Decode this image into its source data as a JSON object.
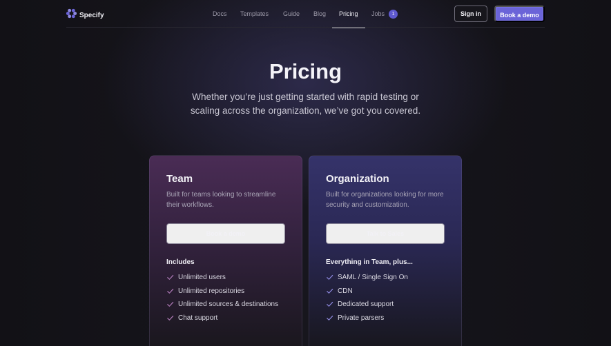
{
  "header": {
    "brand": "Specify",
    "nav": [
      {
        "label": "Docs"
      },
      {
        "label": "Templates"
      },
      {
        "label": "Guide"
      },
      {
        "label": "Blog"
      },
      {
        "label": "Pricing",
        "active": true
      },
      {
        "label": "Jobs",
        "badge": "1"
      }
    ],
    "signin_label": "Sign in",
    "demo_label": "Book a demo"
  },
  "hero": {
    "title": "Pricing",
    "subtitle": "Whether you’re just getting started with rapid testing or scaling across the organization, we’ve got you covered."
  },
  "plans": [
    {
      "name": "Team",
      "description": "Built for teams looking to streamline their workflows.",
      "cta": "Book a demo",
      "includes_label": "Includes",
      "features": [
        "Unlimited users",
        "Unlimited repositories",
        "Unlimited sources & destinations",
        "Chat support"
      ]
    },
    {
      "name": "Organization",
      "description": "Built for organizations looking for more security and customization.",
      "cta": "Talk to Sales",
      "includes_label": "Everything in Team, plus...",
      "features": [
        "SAML / Single Sign On",
        "CDN",
        "Dedicated support",
        "Private parsers"
      ]
    }
  ],
  "colors": {
    "accent": "#6b64d8",
    "team_card": "#4a2c55",
    "org_card": "#35336a",
    "check_team": "#b07ab8",
    "check_org": "#8f8ae0"
  },
  "icons": {
    "logo": "specify-logo-icon",
    "check": "check-icon"
  }
}
